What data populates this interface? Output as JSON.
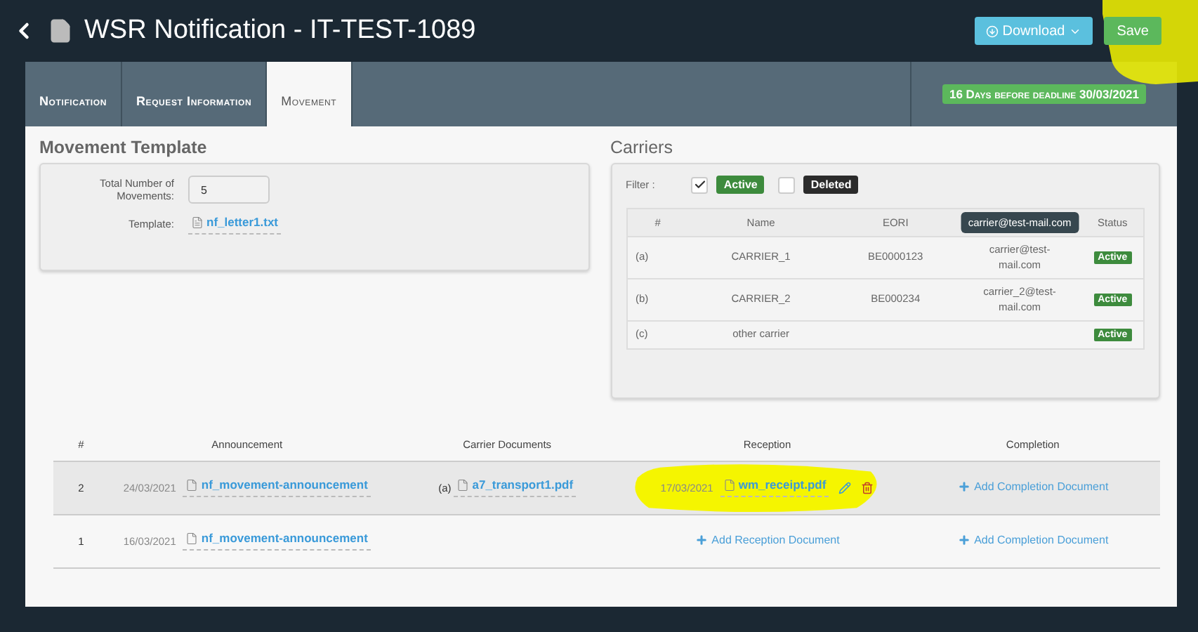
{
  "header": {
    "title": "WSR Notification - IT-TEST-1089",
    "download": "Download",
    "save": "Save"
  },
  "tabs": [
    {
      "label": "Notification",
      "selected": false
    },
    {
      "label": "Request Information",
      "selected": false
    },
    {
      "label": "Movement",
      "selected": true
    }
  ],
  "deadline": "16 Days before deadline 30/03/2021",
  "template": {
    "title": "Movement Template",
    "total_label": "Total Number of Movements:",
    "total_value": "5",
    "template_label": "Template:",
    "template_file": "nf_letter1.txt"
  },
  "carriers": {
    "title": "Carriers",
    "filter_label": "Filter :",
    "filters": [
      {
        "label": "Active",
        "checked": true,
        "color": "#3d8b3d"
      },
      {
        "label": "Deleted",
        "checked": false,
        "color": "#2b2b2b"
      }
    ],
    "columns": [
      {
        "label": "#"
      },
      {
        "label": "Name"
      },
      {
        "label": "EORI"
      },
      {
        "tooltip": "carrier@test-mail.com"
      },
      {
        "label": "Status"
      }
    ],
    "rows": [
      {
        "index": "(a)",
        "name": "CARRIER_1",
        "eori": "BE0000123",
        "email": "carrier@test-mail.com",
        "status": "Active"
      },
      {
        "index": "(b)",
        "name": "CARRIER_2",
        "eori": "BE000234",
        "email": "carrier_2@test-mail.com",
        "status": "Active"
      },
      {
        "index": "(c)",
        "name": "other carrier",
        "status": "Active"
      }
    ]
  },
  "movements": {
    "columns": [
      "#",
      "Announcement",
      "Carrier Documents",
      "Reception",
      "Completion"
    ],
    "rows": [
      {
        "number": "2",
        "selected": true,
        "announcement": {
          "date": "24/03/2021",
          "file": "nf_movement-announcement"
        },
        "carrier_docs": [
          {
            "index": "(a)",
            "file": "a7_transport1.pdf"
          }
        ],
        "reception": {
          "date": "17/03/2021",
          "file": "wm_receipt.pdf"
        },
        "completion_action": "Add Completion Document"
      },
      {
        "number": "1",
        "selected": false,
        "announcement": {
          "date": "16/03/2021",
          "file": "nf_movement-announcement"
        },
        "reception_action": "Add Reception Document",
        "completion_action": "Add Completion Document"
      }
    ]
  }
}
